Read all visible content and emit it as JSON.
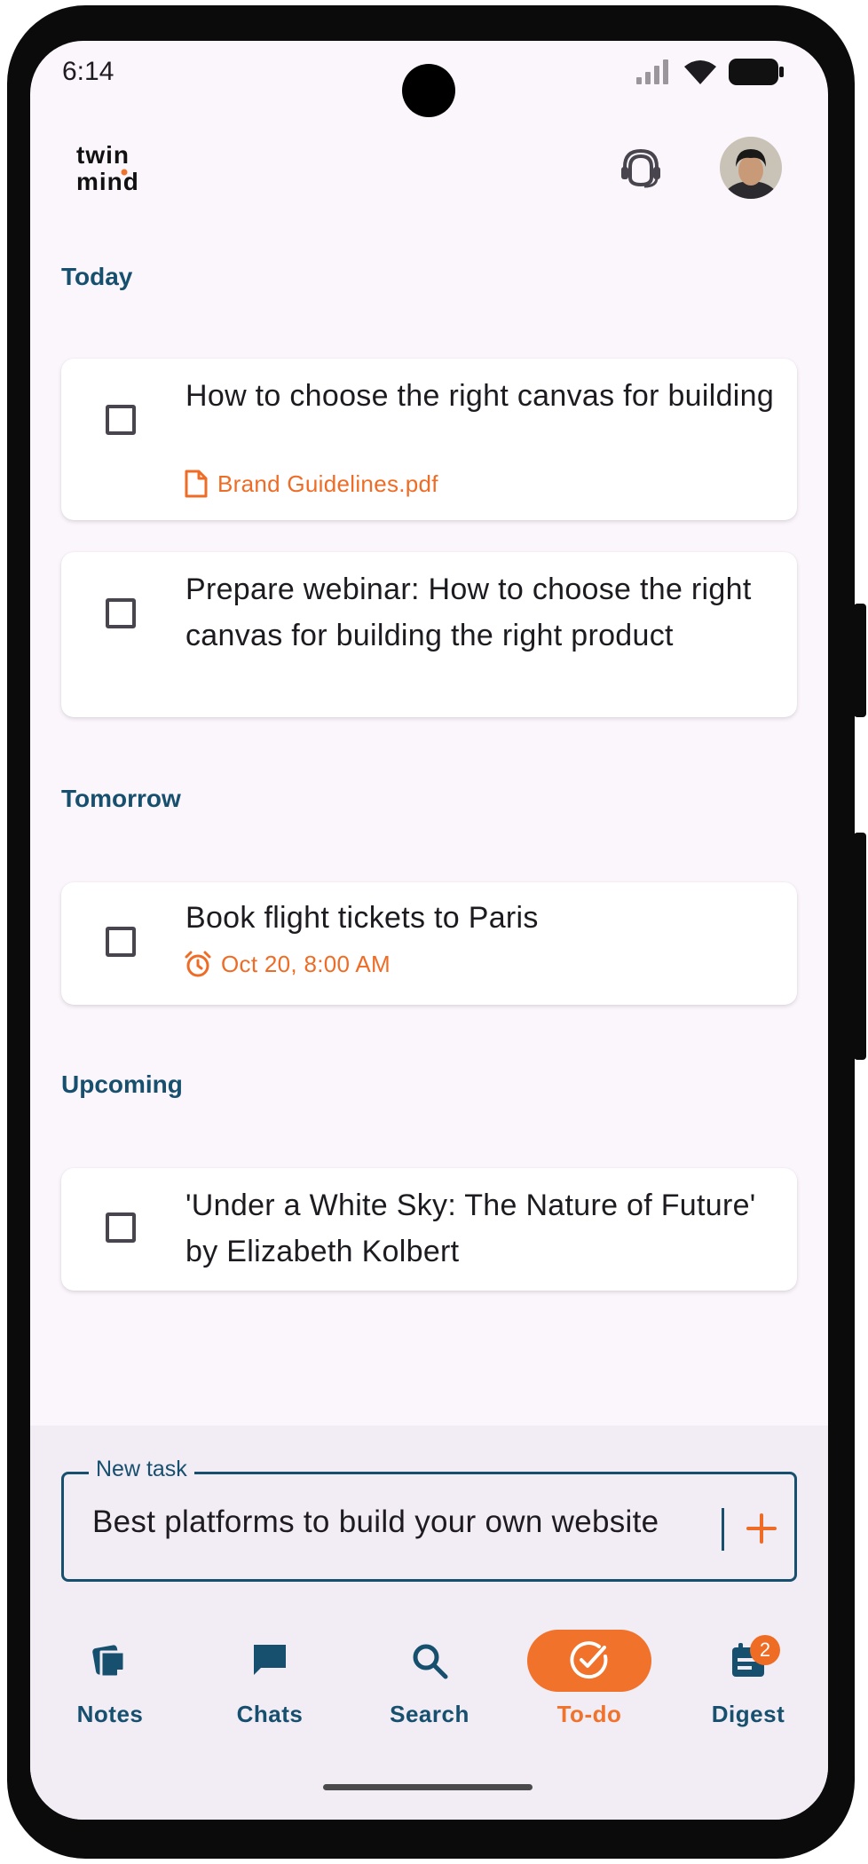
{
  "status_bar": {
    "time": "6:14"
  },
  "header": {
    "logo_text_top": "twin",
    "logo_text_bottom": "mind",
    "support_icon": "support-agent-icon",
    "avatar_icon": "profile-avatar"
  },
  "sections": [
    {
      "title": "Today",
      "tasks": [
        {
          "title": "How to choose the right canvas for building",
          "meta_icon": "file-icon",
          "meta": "Brand Guidelines.pdf"
        },
        {
          "title": "Prepare webinar: How to choose the right canvas for building the right product"
        }
      ]
    },
    {
      "title": "Tomorrow",
      "tasks": [
        {
          "title": "Book flight tickets to Paris",
          "meta_icon": "alarm-icon",
          "meta": "Oct 20, 8:00 AM"
        }
      ]
    },
    {
      "title": "Upcoming",
      "tasks": [
        {
          "title": "'Under a White Sky: The Nature of Future' by Elizabeth Kolbert"
        }
      ]
    }
  ],
  "new_task": {
    "label": "New task",
    "value": "Best platforms to build your own website",
    "add_icon": "plus-icon"
  },
  "nav": [
    {
      "label": "Notes",
      "icon": "notes-icon"
    },
    {
      "label": "Chats",
      "icon": "chat-icon"
    },
    {
      "label": "Search",
      "icon": "search-icon"
    },
    {
      "label": "To-do",
      "icon": "check-circle-icon",
      "active": true
    },
    {
      "label": "Digest",
      "icon": "digest-icon",
      "badge": "2"
    }
  ],
  "colors": {
    "accent": "#f0722b",
    "primary": "#17506e",
    "background": "#fbf5fc"
  }
}
